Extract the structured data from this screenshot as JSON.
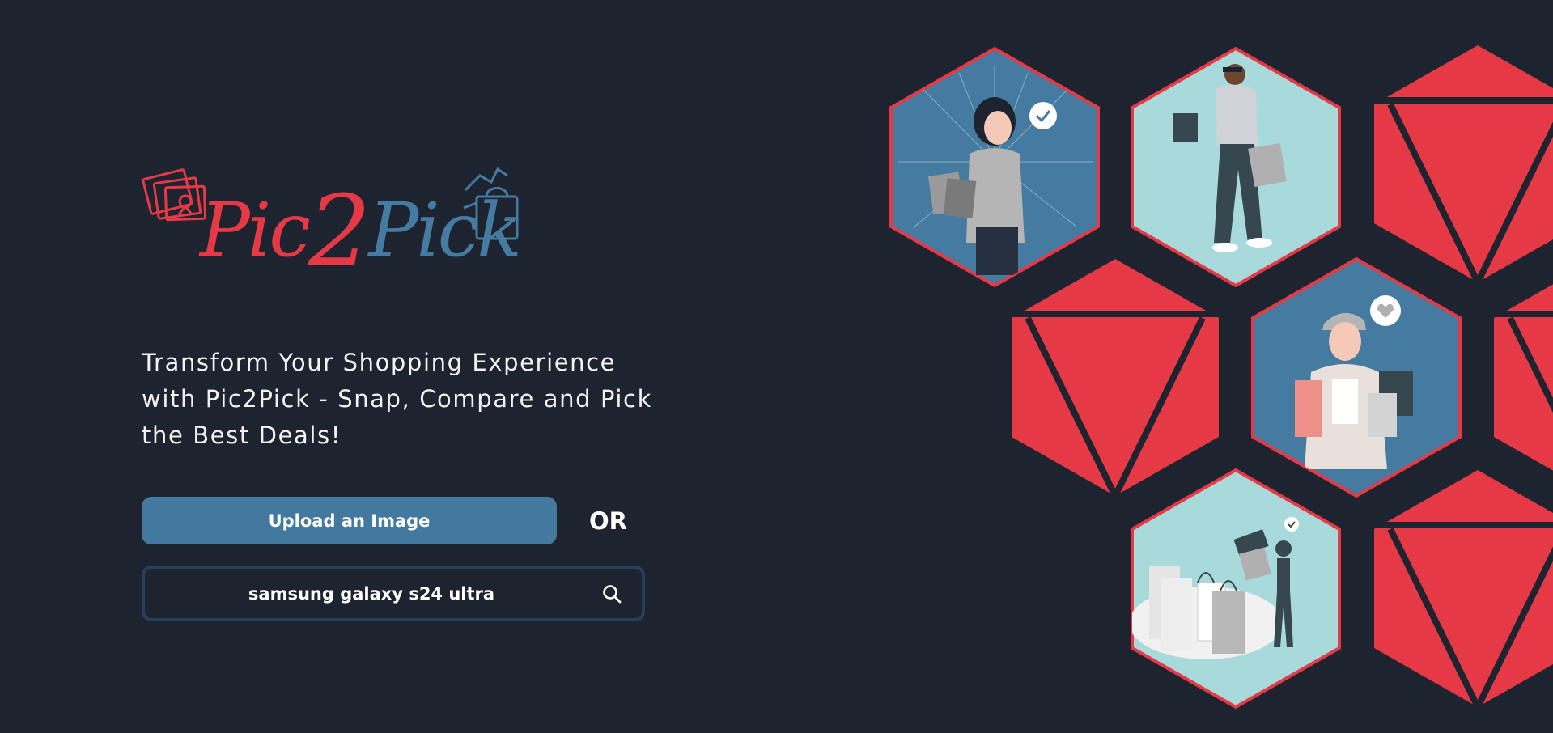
{
  "brand": {
    "logo_word_1": "Pic",
    "logo_word_2": "2",
    "logo_word_3": "Pick",
    "colors": {
      "red": "#e63946",
      "blue": "#457ba1",
      "background": "#1d232f",
      "light_teal": "#a8dadc"
    }
  },
  "hero": {
    "tagline": "Transform Your Shopping Experience with Pic2Pick - Snap, Compare and Pick the Best Deals!"
  },
  "actions": {
    "upload_label": "Upload an Image",
    "or_label": "OR"
  },
  "search": {
    "value": "samsung galaxy s24 ultra",
    "icon": "search-icon"
  },
  "gallery": {
    "illustrations": [
      {
        "name": "woman-shopping-bags-checkmark",
        "icon": "checkmark-bubble"
      },
      {
        "name": "man-walking-with-bags",
        "icon": ""
      },
      {
        "name": "woman-thumbs-up-heart",
        "icon": "heart-bubble"
      },
      {
        "name": "woman-sale-discount-tag",
        "icon": "checkmark-bubble"
      }
    ]
  }
}
